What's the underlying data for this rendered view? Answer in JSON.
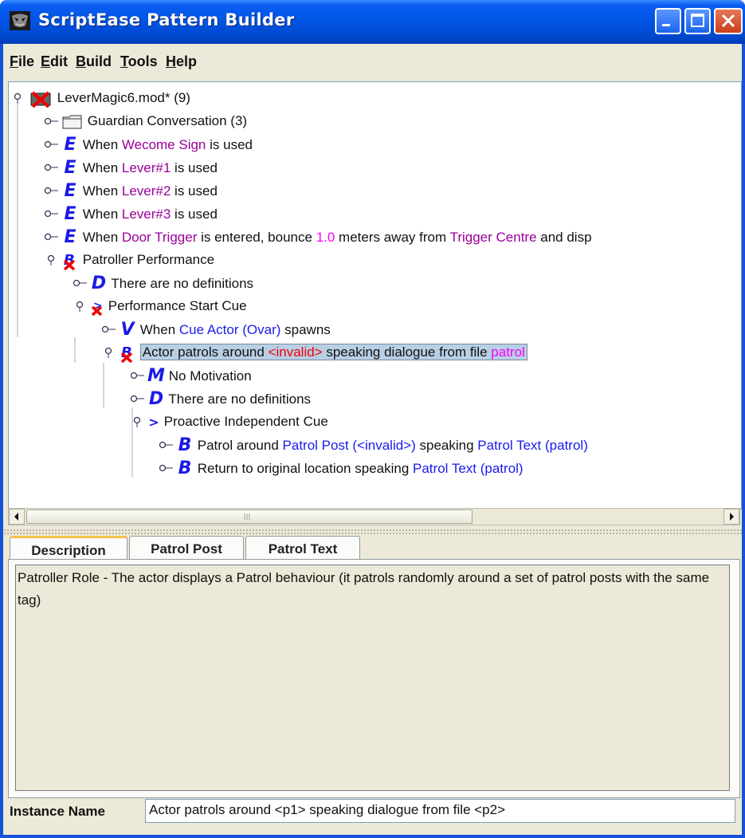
{
  "window": {
    "title": "ScriptEase Pattern Builder"
  },
  "menu": [
    {
      "label": "File",
      "mnemonic": "F",
      "rest": "ile"
    },
    {
      "label": "Edit",
      "mnemonic": "E",
      "rest": "dit"
    },
    {
      "label": "Build",
      "mnemonic": "B",
      "rest": "uild"
    },
    {
      "label": "Tools",
      "mnemonic": "T",
      "rest": "ools"
    },
    {
      "label": "Help",
      "mnemonic": "H",
      "rest": "elp"
    }
  ],
  "tree": {
    "root": "LeverMagic6.mod* (9)",
    "guardian": "Guardian Conversation (3)",
    "welcome": {
      "icon": "E",
      "pre": "When ",
      "name": "Wecome Sign",
      "post": " is used"
    },
    "lever1": {
      "icon": "E",
      "pre": "When ",
      "name": "Lever#1",
      "post": " is used"
    },
    "lever2": {
      "icon": "E",
      "pre": "When ",
      "name": "Lever#2",
      "post": " is used"
    },
    "lever3": {
      "icon": "E",
      "pre": "When ",
      "name": "Lever#3",
      "post": " is used"
    },
    "door": {
      "icon": "E",
      "pre": "When ",
      "name": "Door Trigger",
      "mid": " is entered, bounce ",
      "num": "1.0",
      "mid2": " meters away from ",
      "name2": "Trigger Centre",
      "post": " and disp"
    },
    "patroller": "Patroller Performance",
    "no_defs_1": {
      "icon": "D",
      "text": "There are no definitions"
    },
    "start_cue": "Performance Start Cue",
    "spawns": {
      "icon": "V",
      "pre": "When ",
      "name": "Cue Actor (Ovar)",
      "post": " spawns"
    },
    "actor_patrols": {
      "pre": "Actor patrols around ",
      "invalid": "<invalid>",
      "mid": " speaking dialogue from file ",
      "file": "patrol"
    },
    "no_motivation": {
      "icon": "M",
      "text": "No Motivation"
    },
    "no_defs_2": {
      "icon": "D",
      "text": "There are no definitions"
    },
    "proactive": {
      "icon": ">",
      "text": "Proactive Independent Cue"
    },
    "patrol_around": {
      "icon": "B",
      "pre": "Patrol around ",
      "name": "Patrol Post (<invalid>)",
      "mid": " speaking ",
      "name2": "Patrol Text (patrol)"
    },
    "return_loc": {
      "icon": "B",
      "pre": "Return to original location speaking ",
      "name": "Patrol Text (patrol)"
    }
  },
  "tabs": [
    "Description",
    "Patrol Post",
    "Patrol Text"
  ],
  "description": "Patroller Role - The actor displays a Patrol behaviour (it patrols randomly around a set of patrol posts with the same tag)",
  "instance": {
    "label": "Instance Name",
    "value": "Actor patrols around <p1> speaking dialogue from file <p2>"
  }
}
